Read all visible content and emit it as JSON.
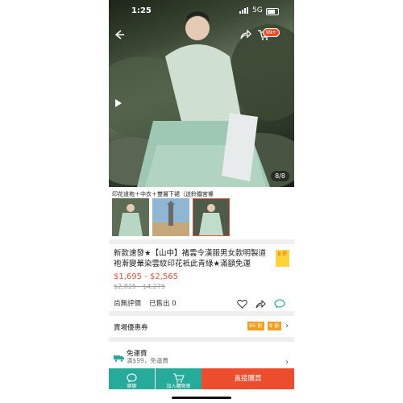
{
  "status_bar": {
    "time": "1:25",
    "network": "5G"
  },
  "hero": {
    "image_counter": "8/8",
    "cart_badge": "99+"
  },
  "variant": {
    "title": "印花道袍＋中衣＋雙層下裙（送鈴鐺宮絛"
  },
  "product": {
    "title": "新款速發★【山中】褚雲令漢服男女款明製道袍漸變暈染雲紋印花袛此青綠★滿額免運",
    "badge": "8 折",
    "price": "$1,695 - $2,565",
    "original_price": "$2,825 - $4,275",
    "rating_text": "尚無評價",
    "sold_text": "已售出 0"
  },
  "vouchers": {
    "label": "賣場優惠券",
    "tag1": "95 折",
    "tag2": "9 折"
  },
  "shipping": {
    "label": "免運費",
    "sub": "滿$99，免運費"
  },
  "bottom_bar": {
    "chat_label": "聊聊",
    "cart_label": "加入購物車",
    "buy_label": "直接購買"
  },
  "colors": {
    "brand": "#ee4d2d",
    "teal": "#26aa99",
    "badge_yellow": "#ffd43b",
    "tag_orange": "#f0a020"
  },
  "icons": [
    "back-arrow-icon",
    "share-icon",
    "cart-icon",
    "video-play-icon",
    "heart-icon",
    "chat-icon",
    "voucher-icon",
    "truck-icon",
    "chevron-right-icon"
  ]
}
